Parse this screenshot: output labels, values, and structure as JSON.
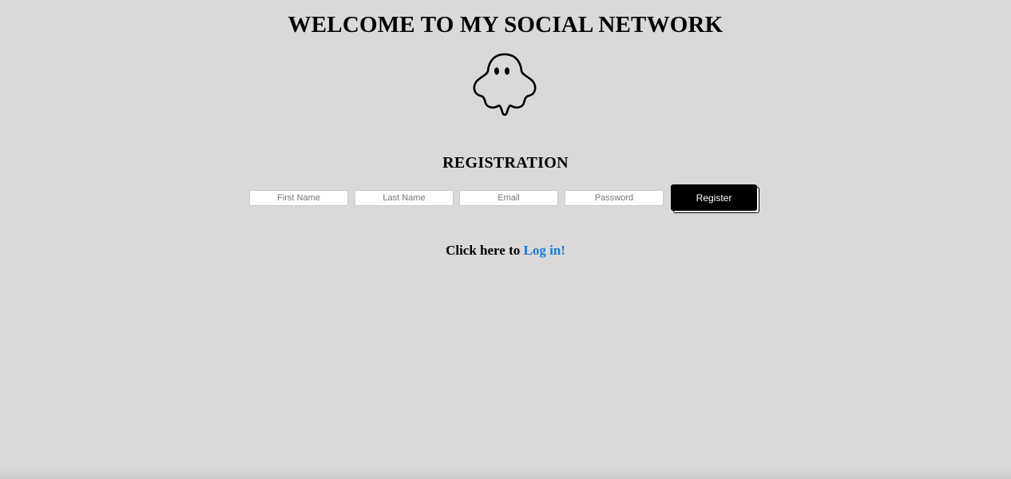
{
  "header": {
    "title": "WELCOME TO MY SOCIAL NETWORK",
    "logo_icon": "ghost-icon"
  },
  "registration": {
    "title": "REGISTRATION",
    "fields": {
      "first_name": {
        "value": "",
        "placeholder": "First Name"
      },
      "last_name": {
        "value": "",
        "placeholder": "Last Name"
      },
      "email": {
        "value": "",
        "placeholder": "Email"
      },
      "password": {
        "value": "",
        "placeholder": "Password"
      }
    },
    "submit_label": "Register"
  },
  "login": {
    "prompt": "Click here to ",
    "link_label": "Log in!"
  },
  "colors": {
    "background": "#dad8d9",
    "button": "#000000",
    "button_text": "#ffffff",
    "link": "#1a7bd9"
  }
}
